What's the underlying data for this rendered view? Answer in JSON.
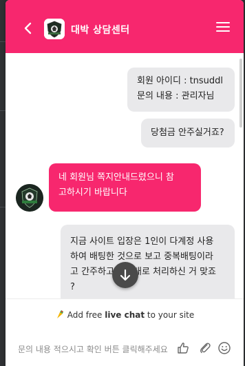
{
  "header": {
    "title": "대박 상담센터",
    "accent_color": "#f7276e",
    "back_icon": "chevron-left-icon",
    "menu_icon": "hamburger-menu-icon"
  },
  "messages": [
    {
      "sender": "visitor",
      "lines": [
        "회원 아이디 : tnsuddl",
        "문의 내용 : 관리자님"
      ]
    },
    {
      "sender": "visitor",
      "lines": [
        "당첨금 안주실거죠?"
      ]
    },
    {
      "sender": "agent",
      "lines": [
        "네  회원님  쪽지안내드렸으니 참",
        "고하시기 바랍니다"
      ]
    },
    {
      "sender": "visitor",
      "lines": [
        "지금 사이트 입장은 1인이 다계정 사용",
        "하여 배팅한 것으로 보고 중복배팅이라",
        "고 간주하고 규정대로 처리하신 거 맞죠",
        "?"
      ]
    }
  ],
  "brand": {
    "prefix": "Add free ",
    "bold": "live chat",
    "suffix": " to your site"
  },
  "composer": {
    "placeholder": "문의 내용 적으시고 확인 버튼 클릭해주세요",
    "icons": [
      "thumbs-up-icon",
      "paperclip-icon",
      "emoji-icon"
    ]
  },
  "scroll_down_icon": "arrow-down-icon"
}
